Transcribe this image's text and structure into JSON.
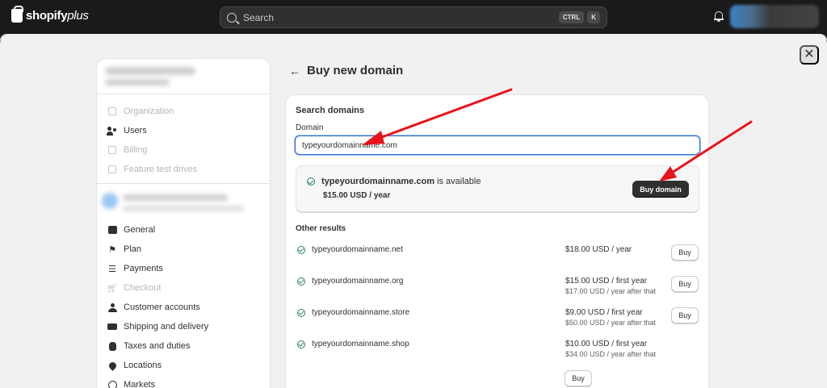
{
  "topbar": {
    "logo_text": "shopify",
    "logo_plus": "plus",
    "search_placeholder": "Search",
    "shortcut_key1": "CTRL",
    "shortcut_key2": "K"
  },
  "modal": {
    "close_label": "✕"
  },
  "sidebar": {
    "section1": [
      {
        "label": "Organization",
        "icon": "building-icon",
        "muted": true
      },
      {
        "label": "Users",
        "icon": "users-icon",
        "muted": false
      },
      {
        "label": "Billing",
        "icon": "receipt-icon",
        "muted": true
      },
      {
        "label": "Feature test drives",
        "icon": "clipboard-icon",
        "muted": true
      }
    ],
    "section2": [
      {
        "label": "General",
        "icon": "store-icon",
        "muted": false
      },
      {
        "label": "Plan",
        "icon": "flag-icon",
        "muted": false
      },
      {
        "label": "Payments",
        "icon": "payments-icon",
        "muted": false
      },
      {
        "label": "Checkout",
        "icon": "cart-icon",
        "muted": true
      },
      {
        "label": "Customer accounts",
        "icon": "person-icon",
        "muted": false
      },
      {
        "label": "Shipping and delivery",
        "icon": "truck-icon",
        "muted": false
      },
      {
        "label": "Taxes and duties",
        "icon": "tax-bag-icon",
        "muted": false
      },
      {
        "label": "Locations",
        "icon": "location-pin-icon",
        "muted": false
      },
      {
        "label": "Markets",
        "icon": "globe-icon",
        "muted": false
      }
    ]
  },
  "page": {
    "back_label": "←",
    "title": "Buy new domain"
  },
  "search_card": {
    "title": "Search domains",
    "field_label": "Domain",
    "field_value": "typeyourdomainname.com"
  },
  "available": {
    "domain": "typeyourdomainname.com",
    "suffix": "is available",
    "price": "$15.00 USD / year",
    "button_label": "Buy domain"
  },
  "other": {
    "title": "Other results",
    "results": [
      {
        "domain": "typeyourdomainname.net",
        "price": "$18.00 USD / year",
        "sub": "",
        "button": "Buy"
      },
      {
        "domain": "typeyourdomainname.org",
        "price": "$15.00 USD / first year",
        "sub": "$17.00 USD / year after that",
        "button": "Buy"
      },
      {
        "domain": "typeyourdomainname.store",
        "price": "$9.00 USD / first year",
        "sub": "$50.00 USD / year after that",
        "button": "Buy"
      },
      {
        "domain": "typeyourdomainname.shop",
        "price": "$10.00 USD / first year",
        "sub": "$34.00 USD / year after that",
        "button": "Buy"
      }
    ]
  },
  "colors": {
    "accent_blue": "#2c6ecb",
    "success_green": "#29845a",
    "annotation_red": "#e8131b",
    "primary_button": "#303030"
  }
}
